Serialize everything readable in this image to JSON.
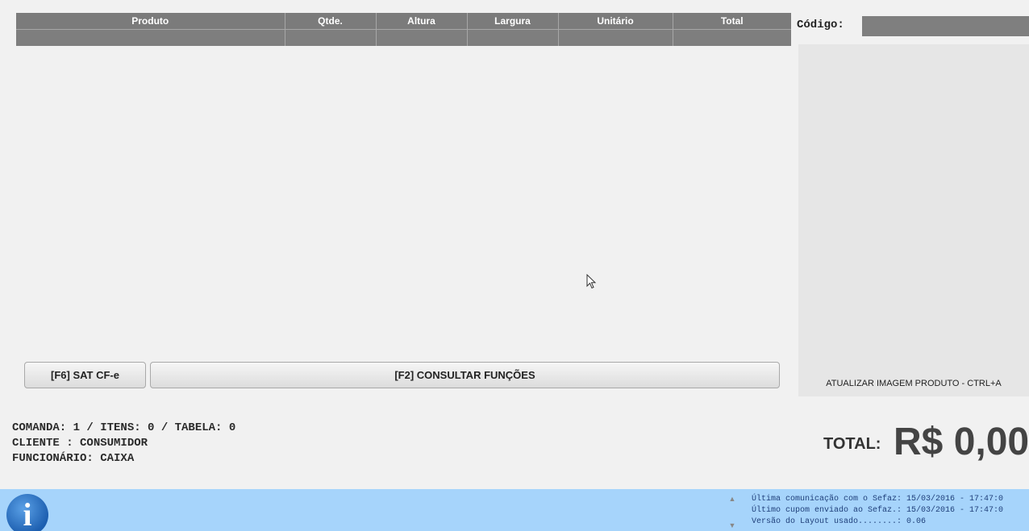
{
  "table": {
    "columns": [
      "Produto",
      "Qtde.",
      "Altura",
      "Largura",
      "Unitário",
      "Total"
    ]
  },
  "right_panel": {
    "codigo_label": "Código:",
    "codigo_value": "",
    "image_caption": "ATUALIZAR IMAGEM PRODUTO - CTRL+A"
  },
  "buttons": {
    "f6_label": "[F6] SAT CF-e",
    "f2_label": "[F2] CONSULTAR FUNÇÕES"
  },
  "info": {
    "line1": "COMANDA: 1 / ITENS: 0 / TABELA: 0",
    "line2": "CLIENTE : CONSUMIDOR",
    "line3": "FUNCIONÁRIO: CAIXA"
  },
  "total": {
    "label": "TOTAL:",
    "value": "R$ 0,00"
  },
  "statusbar": {
    "icon": "info-icon",
    "lines": [
      "Última comunicação com o Sefaz: 15/03/2016 - 17:47:0",
      "Último cupom enviado ao Sefaz.: 15/03/2016 - 17:47:0",
      "Versão do Layout usado........: 0.06"
    ]
  }
}
